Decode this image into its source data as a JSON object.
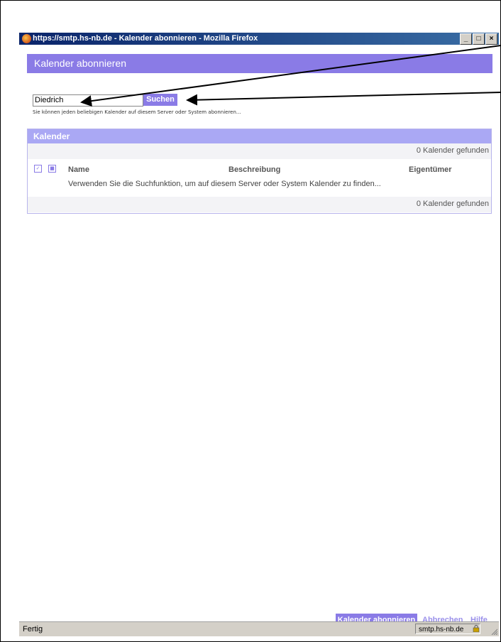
{
  "window": {
    "title": "https://smtp.hs-nb.de - Kalender abonnieren - Mozilla Firefox",
    "buttons": [
      "_",
      "□",
      "×"
    ]
  },
  "header": {
    "title": "Kalender abonnieren"
  },
  "search": {
    "value": "Diedrich",
    "button_label": "Suchen",
    "hint": "Sie können jeden beliebigen Kalender auf diesem Server oder System abonnieren..."
  },
  "panel": {
    "title": "Kalender",
    "count_top": "0 Kalender gefunden",
    "count_bottom": "0 Kalender gefunden",
    "columns": {
      "name": "Name",
      "description": "Beschreibung",
      "owner": "Eigentümer"
    },
    "empty_message": "Verwenden Sie die Suchfunktion, um auf diesem Server oder System Kalender zu finden..."
  },
  "footer": {
    "subscribe_label": "Kalender abonnieren",
    "cancel_label": "Abbrechen",
    "help_label": "Hilfe"
  },
  "statusbar": {
    "status": "Fertig",
    "host": "smtp.hs-nb.de"
  },
  "colors": {
    "accent": "#8a7be6",
    "panel_head": "#aaa8f4"
  }
}
